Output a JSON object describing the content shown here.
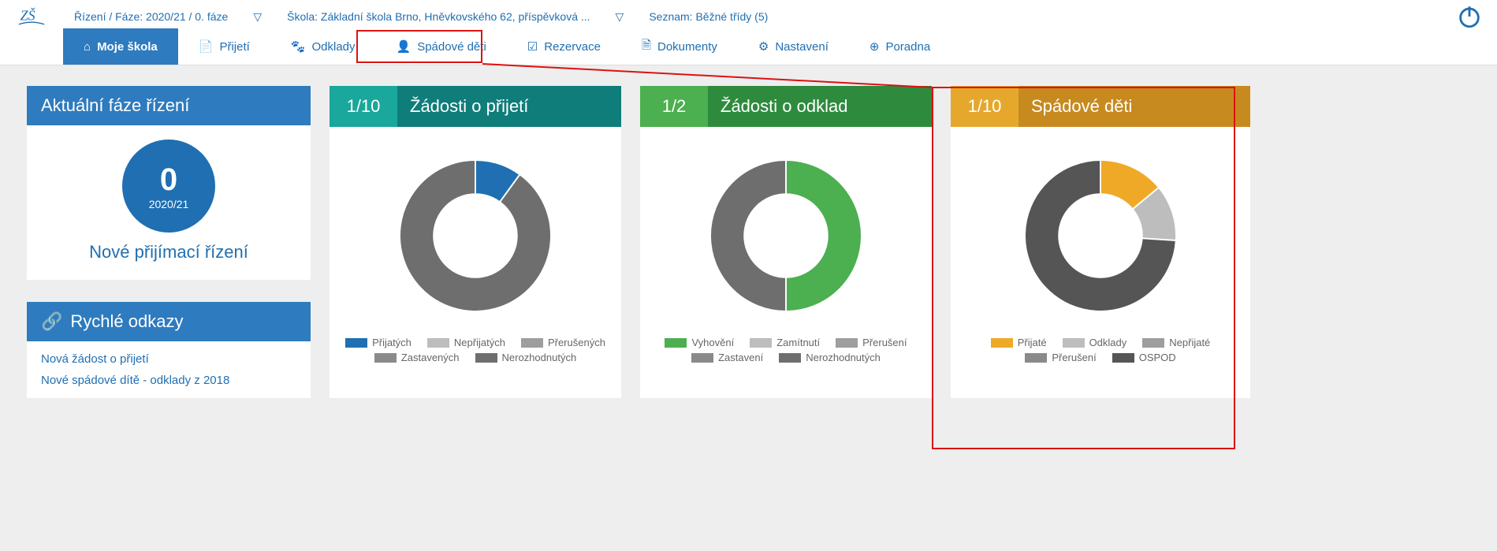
{
  "crumbs": {
    "phase": "Řízení / Fáze: 2020/21 / 0. fáze",
    "school": "Škola: Základní škola Brno, Hněvkovského 62, příspěvková ...",
    "list": "Seznam: Běžné třídy (5)"
  },
  "nav": {
    "home": "Moje škola",
    "accept": "Přijetí",
    "deferrals": "Odklady",
    "catchment": "Spádové děti",
    "reservations": "Rezervace",
    "documents": "Dokumenty",
    "settings": "Nastavení",
    "help": "Poradna"
  },
  "phase": {
    "title": "Aktuální fáze řízení",
    "number": "0",
    "year": "2020/21",
    "link": "Nové přijímací řízení"
  },
  "quicklinks": {
    "title": "Rychlé odkazy",
    "items": [
      "Nová žádost o přijetí",
      "Nové spádové dítě - odklady z 2018"
    ]
  },
  "charts": [
    {
      "fraction": "1/10",
      "title": "Žádosti o přijetí"
    },
    {
      "fraction": "1/2",
      "title": "Žádosti o odklad"
    },
    {
      "fraction": "1/10",
      "title": "Spádové děti"
    }
  ],
  "chart_data": [
    {
      "type": "pie",
      "title": "Žádosti o přijetí",
      "series": [
        {
          "name": "Přijatých",
          "value": 10,
          "color": "#1f6fb2"
        },
        {
          "name": "Nepřijatých",
          "value": 0,
          "color": "#bdbdbd"
        },
        {
          "name": "Přerušených",
          "value": 0,
          "color": "#9e9e9e"
        },
        {
          "name": "Zastavených",
          "value": 0,
          "color": "#8a8a8a"
        },
        {
          "name": "Nerozhodnutých",
          "value": 90,
          "color": "#6e6e6e"
        }
      ]
    },
    {
      "type": "pie",
      "title": "Žádosti o odklad",
      "series": [
        {
          "name": "Vyhovění",
          "value": 50,
          "color": "#4caf50"
        },
        {
          "name": "Zamítnutí",
          "value": 0,
          "color": "#bdbdbd"
        },
        {
          "name": "Přerušení",
          "value": 0,
          "color": "#9e9e9e"
        },
        {
          "name": "Zastavení",
          "value": 0,
          "color": "#8a8a8a"
        },
        {
          "name": "Nerozhodnutých",
          "value": 50,
          "color": "#6e6e6e"
        }
      ]
    },
    {
      "type": "pie",
      "title": "Spádové děti",
      "series": [
        {
          "name": "Přijaté",
          "value": 14,
          "color": "#f0a926"
        },
        {
          "name": "Odklady",
          "value": 12,
          "color": "#bdbdbd"
        },
        {
          "name": "Nepřijaté",
          "value": 0,
          "color": "#9e9e9e"
        },
        {
          "name": "Přerušení",
          "value": 0,
          "color": "#8a8a8a"
        },
        {
          "name": "OSPOD",
          "value": 74,
          "color": "#555555"
        }
      ]
    }
  ]
}
